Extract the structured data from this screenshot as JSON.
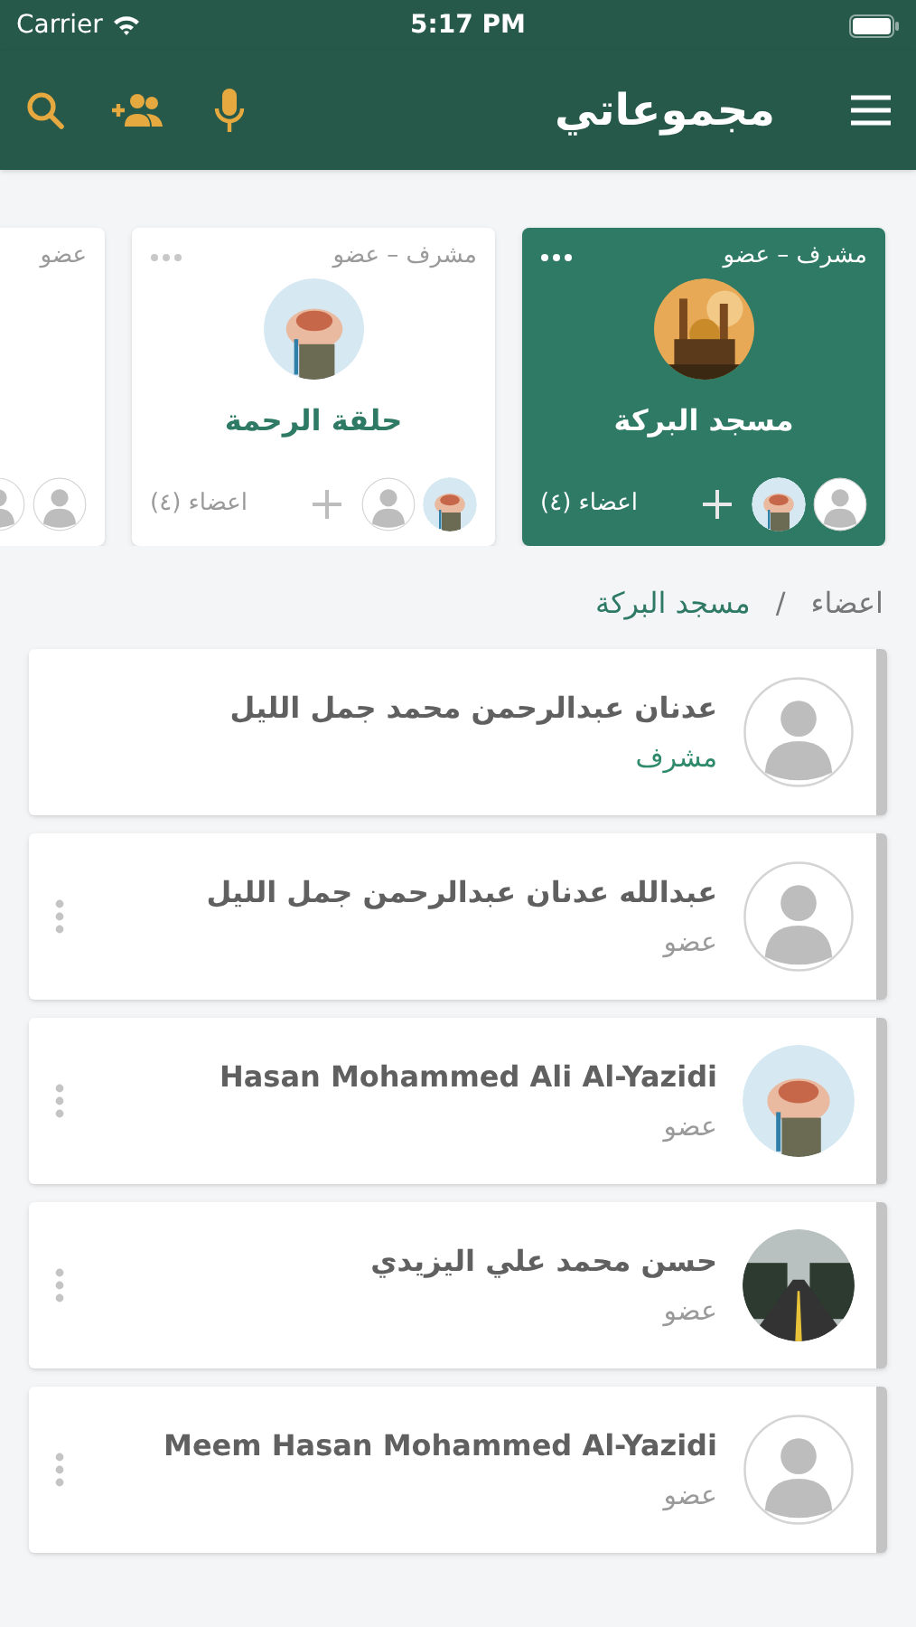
{
  "status_bar": {
    "carrier": "Carrier",
    "time": "5:17 PM"
  },
  "header": {
    "title": "مجموعاتي"
  },
  "groups": [
    {
      "role": "مشرف – عضو",
      "title": "مسجد البركة",
      "avatar": {
        "kind": "picture"
      },
      "members": [
        {
          "kind": "person"
        },
        {
          "kind": "picture"
        }
      ],
      "count": "اعضاء (٤)",
      "selected": true
    },
    {
      "role": "مشرف – عضو",
      "title": "حلقة الرحمة",
      "avatar": {
        "kind": "picture"
      },
      "members": [
        {
          "kind": "picture"
        },
        {
          "kind": "person"
        }
      ],
      "count": "اعضاء (٤)",
      "selected": false
    },
    {
      "role": "عضو",
      "members": [
        {
          "kind": "person"
        },
        {
          "kind": "person"
        }
      ],
      "selected": false
    }
  ],
  "breadcrumb": {
    "section": "اعضاء",
    "separator": "/",
    "group": "مسجد البركة"
  },
  "members": [
    {
      "name": "عدنان عبدالرحمن محمد جمل الليل",
      "role": "مشرف",
      "role_highlighted": true,
      "avatar": {
        "kind": "person"
      },
      "menu": false
    },
    {
      "name": "عبدالله عدنان عبدالرحمن جمل الليل",
      "role": "عضو",
      "role_highlighted": false,
      "avatar": {
        "kind": "person"
      },
      "menu": true
    },
    {
      "name": "Hasan Mohammed Ali Al-Yazidi",
      "role": "عضو",
      "role_highlighted": false,
      "avatar": {
        "kind": "picture"
      },
      "menu": true
    },
    {
      "name": "حسن محمد علي اليزيدي",
      "role": "عضو",
      "role_highlighted": false,
      "avatar": {
        "kind": "picture"
      },
      "menu": true
    },
    {
      "name": "Meem Hasan Mohammed Al-Yazidi",
      "role": "عضو",
      "role_highlighted": false,
      "avatar": {
        "kind": "person"
      },
      "menu": true
    }
  ]
}
